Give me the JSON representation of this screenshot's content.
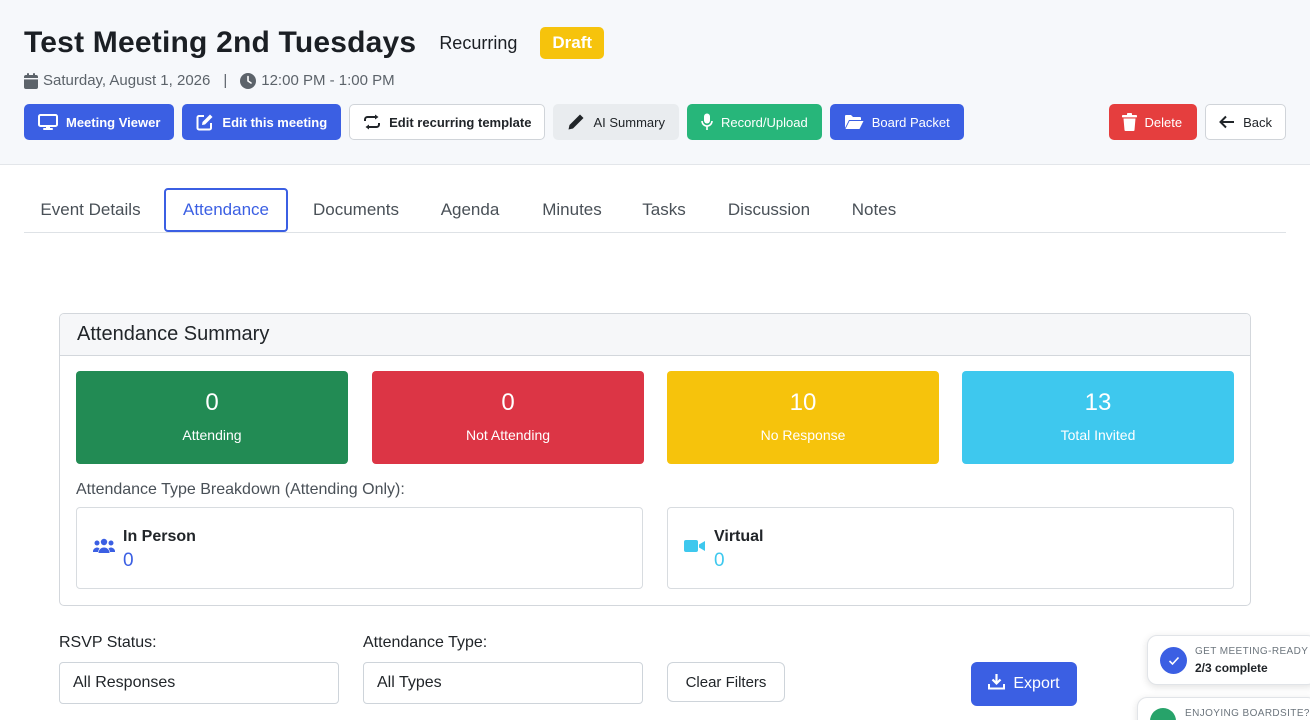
{
  "header": {
    "title": "Test Meeting 2nd Tuesdays",
    "recurring": "Recurring",
    "status_badge": "Draft",
    "date": "Saturday, August 1, 2026",
    "separator": "|",
    "time": "12:00 PM - 1:00 PM"
  },
  "toolbar": {
    "meeting_viewer": "Meeting Viewer",
    "edit_meeting": "Edit this meeting",
    "edit_template": "Edit recurring template",
    "ai_summary": "AI Summary",
    "record_upload": "Record/Upload",
    "board_packet": "Board Packet",
    "delete": "Delete",
    "back": "Back"
  },
  "tabs": [
    "Event Details",
    "Attendance",
    "Documents",
    "Agenda",
    "Minutes",
    "Tasks",
    "Discussion",
    "Notes"
  ],
  "active_tab": "Attendance",
  "summary": {
    "title": "Attendance Summary",
    "stats": [
      {
        "value": "0",
        "label": "Attending",
        "color": "#228b54"
      },
      {
        "value": "0",
        "label": "Not Attending",
        "color": "#dc3545"
      },
      {
        "value": "10",
        "label": "No Response",
        "color": "#f6c30c"
      },
      {
        "value": "13",
        "label": "Total Invited",
        "color": "#3ec8ee"
      }
    ],
    "breakdown_label": "Attendance Type Breakdown (Attending Only):",
    "types": [
      {
        "name": "In Person",
        "value": "0",
        "color": "#3b5fe3",
        "icon": "users-icon"
      },
      {
        "name": "Virtual",
        "value": "0",
        "color": "#3ec8ee",
        "icon": "video-icon"
      }
    ]
  },
  "filters": {
    "rsvp_label": "RSVP Status:",
    "rsvp_value": "All Responses",
    "type_label": "Attendance Type:",
    "type_value": "All Types",
    "clear": "Clear Filters",
    "export": "Export"
  },
  "toasts": {
    "meeting_ready_title": "GET MEETING-READY",
    "meeting_ready_progress": "2/3 complete",
    "enjoying": "ENJOYING BOARDSITE?"
  },
  "colors": {
    "primary": "#3b5fe3",
    "success": "#27b67a",
    "danger": "#e53e3e",
    "warning": "#f6c30c",
    "info": "#3ec8ee"
  }
}
